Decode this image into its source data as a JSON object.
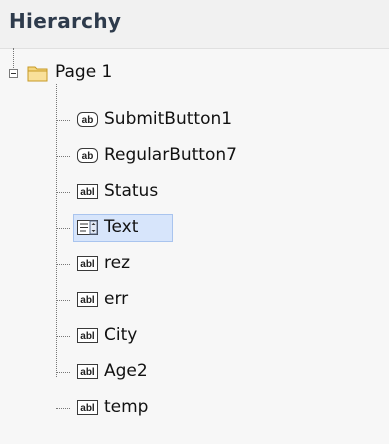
{
  "panel": {
    "title": "Hierarchy"
  },
  "tree": {
    "root": {
      "label": "Page 1",
      "expander": "minus",
      "icon": "folder-icon"
    },
    "items": [
      {
        "label": "SubmitButton1",
        "icon": "button-icon",
        "selected": false
      },
      {
        "label": "RegularButton7",
        "icon": "button-icon",
        "selected": false
      },
      {
        "label": "Status",
        "icon": "label-icon",
        "selected": false
      },
      {
        "label": "Text",
        "icon": "textarea-icon",
        "selected": true
      },
      {
        "label": "rez",
        "icon": "label-icon",
        "selected": false
      },
      {
        "label": "err",
        "icon": "label-icon",
        "selected": false
      },
      {
        "label": "City",
        "icon": "label-icon",
        "selected": false
      },
      {
        "label": "Age2",
        "icon": "label-icon",
        "selected": false
      },
      {
        "label": "temp",
        "icon": "label-icon",
        "selected": false
      }
    ]
  }
}
